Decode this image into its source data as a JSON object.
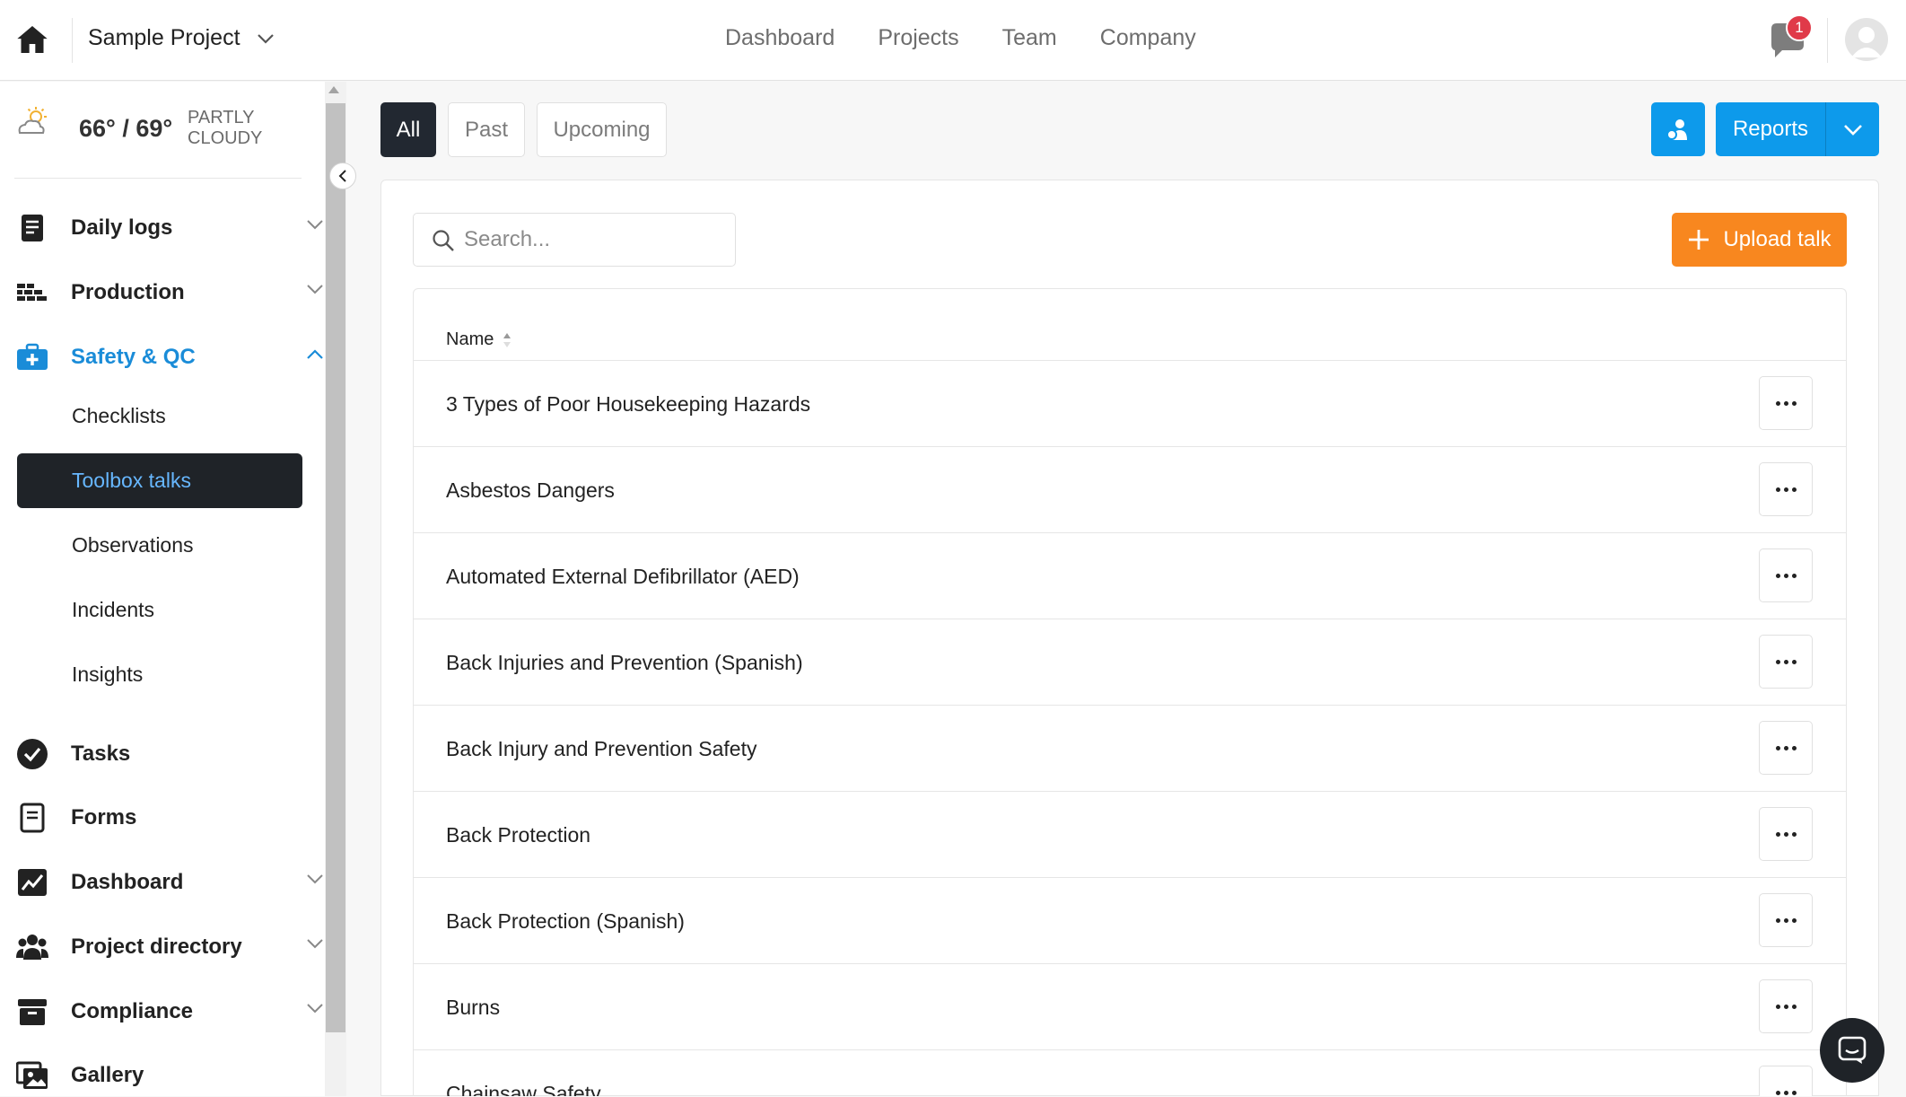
{
  "topbar": {
    "project_name": "Sample Project",
    "nav": [
      "Dashboard",
      "Projects",
      "Team",
      "Company"
    ],
    "notification_count": "1"
  },
  "sidebar": {
    "weather": {
      "temp": "66° / 69°",
      "condition_line1": "PARTLY",
      "condition_line2": "CLOUDY"
    },
    "items": [
      {
        "label": "Daily logs"
      },
      {
        "label": "Production"
      },
      {
        "label": "Safety & QC"
      },
      {
        "label": "Tasks"
      },
      {
        "label": "Forms"
      },
      {
        "label": "Dashboard"
      },
      {
        "label": "Project directory"
      },
      {
        "label": "Compliance"
      },
      {
        "label": "Gallery"
      }
    ],
    "safety_sub": [
      "Checklists",
      "Toolbox talks",
      "Observations",
      "Incidents",
      "Insights"
    ]
  },
  "main": {
    "tabs": [
      "All",
      "Past",
      "Upcoming"
    ],
    "reports_label": "Reports",
    "search_placeholder": "Search...",
    "upload_label": "Upload talk",
    "column_name": "Name",
    "rows": [
      "3 Types of Poor Housekeeping Hazards",
      "Asbestos Dangers",
      "Automated External Defibrillator (AED)",
      "Back Injuries and Prevention (Spanish)",
      "Back Injury and Prevention Safety",
      "Back Protection",
      "Back Protection (Spanish)",
      "Burns",
      "Chainsaw Safety"
    ]
  },
  "colors": {
    "accent_blue": "#0d9aeb",
    "upload_orange": "#f8871f",
    "active_link": "#1a8cd8",
    "dark": "#1f2328"
  }
}
